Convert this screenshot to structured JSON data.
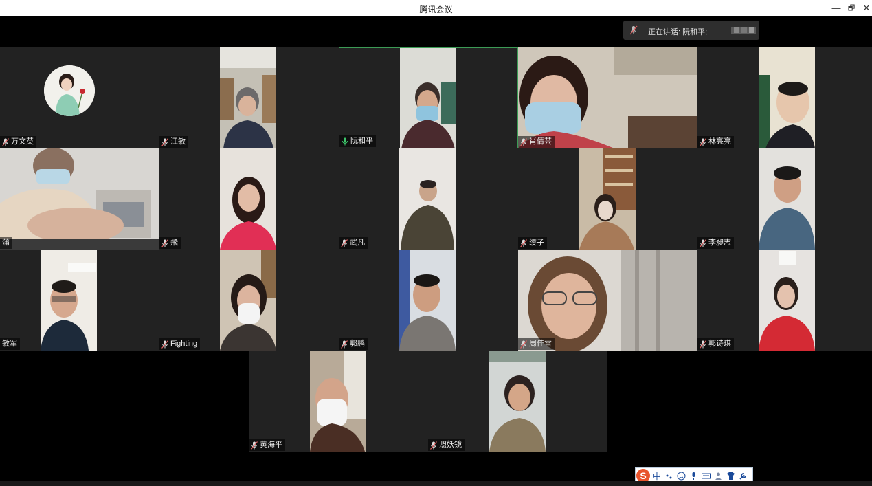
{
  "window": {
    "title": "腾讯会议",
    "minimize": "—",
    "restore": "🗗",
    "close": "✕"
  },
  "speaking": {
    "label": "正在讲话: 阮和平;"
  },
  "participants": [
    {
      "name": "万文英",
      "mic": "muted"
    },
    {
      "name": "江敏",
      "mic": "muted"
    },
    {
      "name": "阮和平",
      "mic": "speaking"
    },
    {
      "name": "肖倩芸",
      "mic": "muted"
    },
    {
      "name": "林亮亮",
      "mic": "muted"
    },
    {
      "name": "蒲",
      "mic": "muted"
    },
    {
      "name": "飛",
      "mic": "muted"
    },
    {
      "name": "武凡",
      "mic": "muted"
    },
    {
      "name": "缨子",
      "mic": "muted"
    },
    {
      "name": "李昶志",
      "mic": "muted"
    },
    {
      "name": "敏军",
      "mic": "muted"
    },
    {
      "name": "Fighting",
      "mic": "muted"
    },
    {
      "name": "郭鹏",
      "mic": "muted"
    },
    {
      "name": "周佳雪",
      "mic": "muted"
    },
    {
      "name": "郭诗琪",
      "mic": "muted"
    },
    {
      "name": "黄海平",
      "mic": "muted"
    },
    {
      "name": "照妖镜",
      "mic": "muted"
    }
  ],
  "ime": {
    "logo": "S",
    "mode": "中",
    "icons": [
      "punctuation-icon",
      "emoji-icon",
      "voice-icon",
      "keyboard-icon",
      "user-icon",
      "skin-icon",
      "tools-icon"
    ]
  },
  "colors": {
    "active_border": "#3c9b55",
    "tile_bg": "#222222",
    "speaking_mic": "#3cc56a",
    "muted_mic": "#e06060"
  }
}
